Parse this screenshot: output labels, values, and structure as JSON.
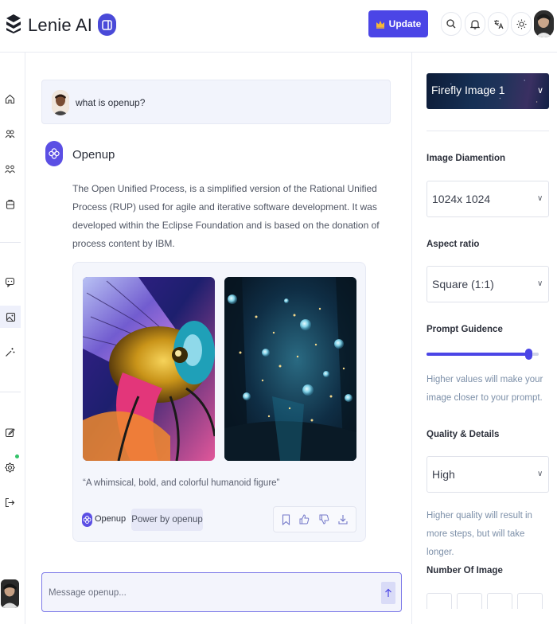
{
  "header": {
    "app_name": "Lenie AI",
    "update_label": "Update",
    "icons": [
      "logo-icon",
      "sidebar-toggle-icon",
      "crown-icon",
      "search-icon",
      "bell-icon",
      "translate-icon",
      "sun-icon",
      "avatar"
    ]
  },
  "rail": {
    "items": [
      "home-icon",
      "users-icon",
      "community-icon",
      "box-icon",
      "chat-bubble-icon",
      "image-icon",
      "magic-wand-icon",
      "edit-icon",
      "settings-icon",
      "logout-icon"
    ],
    "active_item": "image-icon",
    "status_dot_color": "#35c36a"
  },
  "prompt": {
    "text": "what is openup?"
  },
  "response": {
    "bot_name": "Openup",
    "answer": "The Open Unified Process, is a simplified version of the Rational Unified Process (RUP) used for agile and iterative software development. It was developed within the Eclipse Foundation and is based on the donation of process content by IBM.",
    "gallery": {
      "caption": "“A whimsical, bold, and colorful humanoid figure”",
      "brand": "Openup",
      "power_label": "Power by openup"
    }
  },
  "composer": {
    "placeholder": "Message openup..."
  },
  "settings": {
    "model": "Firefly Image 1",
    "image_dimension_label": "Image Diamention",
    "image_dimension_value": "1024x 1024",
    "aspect_ratio_label": "Aspect ratio",
    "aspect_ratio_value": "Square (1:1)",
    "prompt_guidance_label": "Prompt Guidence",
    "prompt_guidance_level": 0.91,
    "prompt_guidance_help": "Higher values will make your image closer to your prompt.",
    "quality_label": "Quality & Details",
    "quality_value": "High",
    "quality_help": "Higher quality will result in more steps, but will take longer.",
    "number_label": "Number Of Image"
  },
  "colors": {
    "accent": "#4b45e6",
    "help_text": "#7c8fa8"
  }
}
